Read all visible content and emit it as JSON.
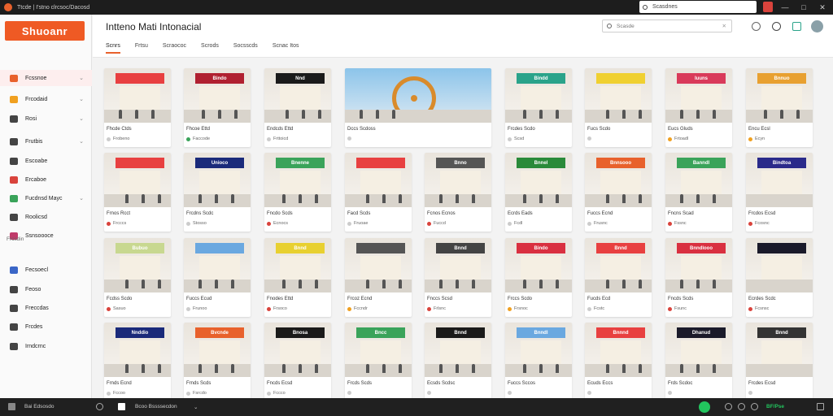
{
  "window": {
    "title": "Ttcde | I'stno clrcsoc/Dacosd",
    "search_placeholder": "Scasdnes"
  },
  "sidebar": {
    "logo": "Shuoanr",
    "items": [
      {
        "label": "Fcssnoe",
        "color": "#e8612c",
        "chevron": true,
        "active": true
      },
      {
        "label": "Frcodaid",
        "color": "#f0a020",
        "chevron": true
      },
      {
        "label": "Rosi",
        "color": "#444444",
        "chevron": true
      },
      {
        "label": "Frutbis",
        "color": "#444444",
        "chevron": true
      },
      {
        "label": "Escoabe",
        "color": "#444444"
      },
      {
        "label": "Ercaboe",
        "color": "#d9433c"
      },
      {
        "label": "Fucdnsd Mayc",
        "color": "#3aa35a",
        "chevron": true
      },
      {
        "label": "Roolicsd",
        "color": "#444444"
      },
      {
        "label": "Ssnsoooce",
        "color": "#c03a6a"
      }
    ],
    "section_label": "Frcsdin",
    "section_items": [
      {
        "label": "Fecsoecl",
        "color": "#3a66c7"
      },
      {
        "label": "Feoso",
        "color": "#444444"
      },
      {
        "label": "Freccdas",
        "color": "#444444"
      },
      {
        "label": "Frcdes",
        "color": "#444444"
      },
      {
        "label": "Irndcrnc",
        "color": "#444444"
      }
    ]
  },
  "header": {
    "title": "Intteno Mati  Intonacial",
    "search_placeholder": "Scasde",
    "tabs": [
      {
        "label": "Scnrs",
        "active": true
      },
      {
        "label": "Frtsu"
      },
      {
        "label": "Scraococ"
      },
      {
        "label": "Scrods"
      },
      {
        "label": "Socsscds"
      },
      {
        "label": "Scnac  Itos"
      }
    ]
  },
  "cards": [
    {
      "label": "Fhcde Ctds",
      "meta": "Frobeno",
      "sign": "",
      "sign_color": "#e84040",
      "dot": "#cccccc"
    },
    {
      "label": "Fhcoe Ettd",
      "meta": "Faccode",
      "sign": "Bindo",
      "sign_color": "#b02030",
      "dot": "#3aa35a"
    },
    {
      "label": "Endcds Ettd",
      "meta": "Frttoicd",
      "sign": "Nnd",
      "sign_color": "#1a1a1a",
      "dot": "#cccccc"
    },
    {
      "label": "Dccs Scdoss",
      "meta": "",
      "sign": "",
      "sign_color": "#8fa6c8",
      "dot": "#cccccc",
      "hero": true
    },
    {
      "label": "Frcdes Scdo",
      "meta": "Scsd",
      "sign": "Bindd",
      "sign_color": "#2aa38a",
      "dot": "#cccccc"
    },
    {
      "label": "Fucs Scdo",
      "meta": "",
      "sign": "",
      "sign_color": "#f0d030",
      "dot": "#cccccc"
    },
    {
      "label": "Eucs Gluds",
      "meta": "Frtoadl",
      "sign": "Iuuns",
      "sign_color": "#d93a5a",
      "dot": "#f0a020"
    },
    {
      "label": "Encu Ecsl",
      "meta": "Ecyn",
      "sign": "Bnnuo",
      "sign_color": "#e8a030",
      "dot": "#f0a020"
    },
    {
      "label": "Frnos Rcct",
      "meta": "Frcccs",
      "sign": "",
      "sign_color": "#e84040",
      "dot": "#d9433c"
    },
    {
      "label": "Frcdns Scdc",
      "meta": "Stosso",
      "sign": "Unioco",
      "sign_color": "#1a2a7a",
      "dot": "#cccccc"
    },
    {
      "label": "Fncdo Scds",
      "meta": "Ecnocs",
      "sign": "Bnenne",
      "sign_color": "#3aa35a",
      "dot": "#d9433c"
    },
    {
      "label": "Facd Scds",
      "meta": "Fruoae",
      "sign": "",
      "sign_color": "#e84040",
      "dot": "#cccccc"
    },
    {
      "label": "Fcnos Ecnos",
      "meta": "Fuccd",
      "sign": "Bnno",
      "sign_color": "#555555",
      "dot": "#d9433c"
    },
    {
      "label": "Ecrds Eads",
      "meta": "Fcdl",
      "sign": "Bnnel",
      "sign_color": "#2a8a3a",
      "dot": "#cccccc"
    },
    {
      "label": "Fuccs Ecnd",
      "meta": "Frusnc",
      "sign": "Bnnsooo",
      "sign_color": "#e8612c",
      "dot": "#cccccc"
    },
    {
      "label": "Fncns Scad",
      "meta": "Fssnc",
      "sign": "Banndl",
      "sign_color": "#3aa35a",
      "dot": "#d9433c"
    },
    {
      "label": "Frcdos Ecsd",
      "meta": "Fcosnc",
      "sign": "Bindtoa",
      "sign_color": "#2a2a8a",
      "dot": "#d9433c"
    },
    {
      "label": "Fcdss Scdo",
      "meta": "Sasuo",
      "sign": "Bubuo",
      "sign_color": "#c8d890",
      "dot": "#d9433c"
    },
    {
      "label": "Fuccs Ecud",
      "meta": "Frunoo",
      "sign": "",
      "sign_color": "#6aa8e0",
      "dot": "#cccccc"
    },
    {
      "label": "Fnodes Ettd",
      "meta": "Frsoco",
      "sign": "Bnnd",
      "sign_color": "#e8d030",
      "dot": "#d9433c"
    },
    {
      "label": "Frcoz Ecnd",
      "meta": "Fccndr",
      "sign": "",
      "sign_color": "#555555",
      "dot": "#f0a020"
    },
    {
      "label": "Fnccs Scsd",
      "meta": "Frlsnc",
      "sign": "Bnnd",
      "sign_color": "#444444",
      "dot": "#d9433c"
    },
    {
      "label": "Frccs Scdo",
      "meta": "Frsnoc",
      "sign": "Bindo",
      "sign_color": "#d93040",
      "dot": "#f0a020"
    },
    {
      "label": "Fucds Ecd",
      "meta": "Fcstc",
      "sign": "Bnnd",
      "sign_color": "#e84040",
      "dot": "#cccccc"
    },
    {
      "label": "Fncds Scds",
      "meta": "Fsunc",
      "sign": "Bnndlooo",
      "sign_color": "#d93040",
      "dot": "#d9433c"
    },
    {
      "label": "Ecrdes Scdc",
      "meta": "Fcsnsc",
      "sign": "",
      "sign_color": "#1a1a2a",
      "dot": "#d9433c"
    },
    {
      "label": "Frnds Ecnd",
      "meta": "Fccoo",
      "sign": "Nnddio",
      "sign_color": "#1a2a7a",
      "dot": "#cccccc"
    },
    {
      "label": "Frnds Scds",
      "meta": "Fsrcdo",
      "sign": "Bvcnde",
      "sign_color": "#e8612c",
      "dot": "#cccccc"
    },
    {
      "label": "Fncds Ecsd",
      "meta": "Fccco",
      "sign": "Bnosa",
      "sign_color": "#1a1a1a",
      "dot": "#cccccc"
    },
    {
      "label": "Frcds Scds",
      "meta": "",
      "sign": "Bncc",
      "sign_color": "#3aa35a",
      "dot": "#cccccc"
    },
    {
      "label": "Ecsds Scdsc",
      "meta": "",
      "sign": "Bnnd",
      "sign_color": "#1a1a1a",
      "dot": "#cccccc"
    },
    {
      "label": "Fuccs Sccos",
      "meta": "",
      "sign": "Bnndl",
      "sign_color": "#6aa8e0",
      "dot": "#cccccc"
    },
    {
      "label": "Ecuds Eccs",
      "meta": "",
      "sign": "Bnnnd",
      "sign_color": "#e84040",
      "dot": "#cccccc"
    },
    {
      "label": "Frds Scdoc",
      "meta": "",
      "sign": "Dhanud",
      "sign_color": "#1a1a2a",
      "dot": "#cccccc"
    },
    {
      "label": "Frcdes Ecsd",
      "meta": "",
      "sign": "Bnnd",
      "sign_color": "#333333",
      "dot": "#cccccc"
    }
  ],
  "statusbar": {
    "left_text": "Bai Edsosdo",
    "mid_text": "Bcoo  Bssssecdon",
    "right_badge": "BF/Pse"
  }
}
